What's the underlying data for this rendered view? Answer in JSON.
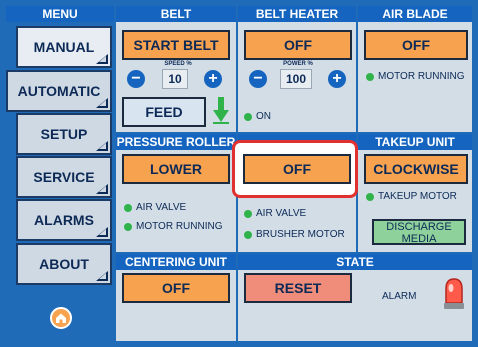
{
  "menu": {
    "header": "MENU",
    "items": [
      {
        "label": "MANUAL",
        "active": true
      },
      {
        "label": "AUTOMATIC"
      },
      {
        "label": "SETUP"
      },
      {
        "label": "SERVICE"
      },
      {
        "label": "ALARMS"
      },
      {
        "label": "ABOUT"
      }
    ],
    "home_icon": "home-icon"
  },
  "belt": {
    "header": "BELT",
    "start_label": "START BELT",
    "speed_caption": "SPEED %",
    "speed_value": "10",
    "minus": "−",
    "plus": "+",
    "feed_label": "FEED",
    "feed_icon": "down-arrow-icon"
  },
  "belt_heater": {
    "header": "BELT HEATER",
    "button_label": "OFF",
    "power_caption": "POWER %",
    "power_value": "100",
    "minus": "−",
    "plus": "+",
    "status": "ON"
  },
  "air_blade": {
    "header": "AIR BLADE",
    "button_label": "OFF",
    "status": "MOTOR RUNNING"
  },
  "pressure_roller": {
    "header": "PRESSURE ROLLER",
    "button_label": "LOWER",
    "status1": "AIR VALVE",
    "status2": "MOTOR RUNNING"
  },
  "brusher": {
    "button_label": "OFF",
    "status1": "AIR VALVE",
    "status2": "BRUSHER MOTOR"
  },
  "takeup": {
    "header": "TAKEUP UNIT",
    "button_label": "CLOCKWISE",
    "status": "TAKEUP MOTOR",
    "discharge_label": "DISCHARGE MEDIA"
  },
  "centering": {
    "header": "CENTERING UNIT",
    "button_label": "OFF"
  },
  "state": {
    "header": "STATE",
    "reset_label": "RESET",
    "alarm_label": "ALARM",
    "alarm_icon": "alarm-beacon-icon"
  },
  "colors": {
    "accent_blue": "#1565c0",
    "orange": "#f7a24f",
    "highlight_red": "#e03030",
    "status_green": "#2fb34a"
  }
}
